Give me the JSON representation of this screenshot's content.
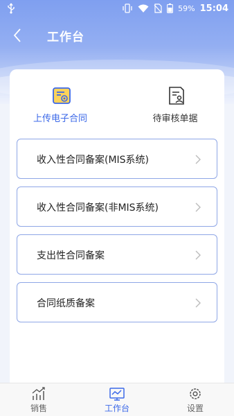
{
  "status_bar": {
    "battery_percent": "59%",
    "time": "15:04",
    "icons": [
      "usb-icon",
      "vibrate-icon",
      "wifi-icon",
      "no-sim-icon",
      "battery-icon"
    ]
  },
  "header": {
    "title": "工作台",
    "back_icon": "back-chevron-icon"
  },
  "tabs": [
    {
      "label": "上传电子合同",
      "icon": "upload-contract-icon",
      "active": true
    },
    {
      "label": "待审核单据",
      "icon": "pending-review-icon",
      "active": false
    }
  ],
  "menu": [
    {
      "label": "收入性合同备案(MIS系统)"
    },
    {
      "label": "收入性合同备案(非MIS系统)"
    },
    {
      "label": "支出性合同备案"
    },
    {
      "label": "合同纸质备案"
    }
  ],
  "bottom_nav": [
    {
      "label": "销售",
      "icon": "sales-chart-icon"
    },
    {
      "label": "工作台",
      "icon": "workbench-icon",
      "active": true
    },
    {
      "label": "设置",
      "icon": "settings-gear-icon"
    }
  ],
  "colors": {
    "accent": "#3b68e8",
    "header_gradient_top": "#7f9ff0",
    "row_border": "#8ea6e6"
  }
}
